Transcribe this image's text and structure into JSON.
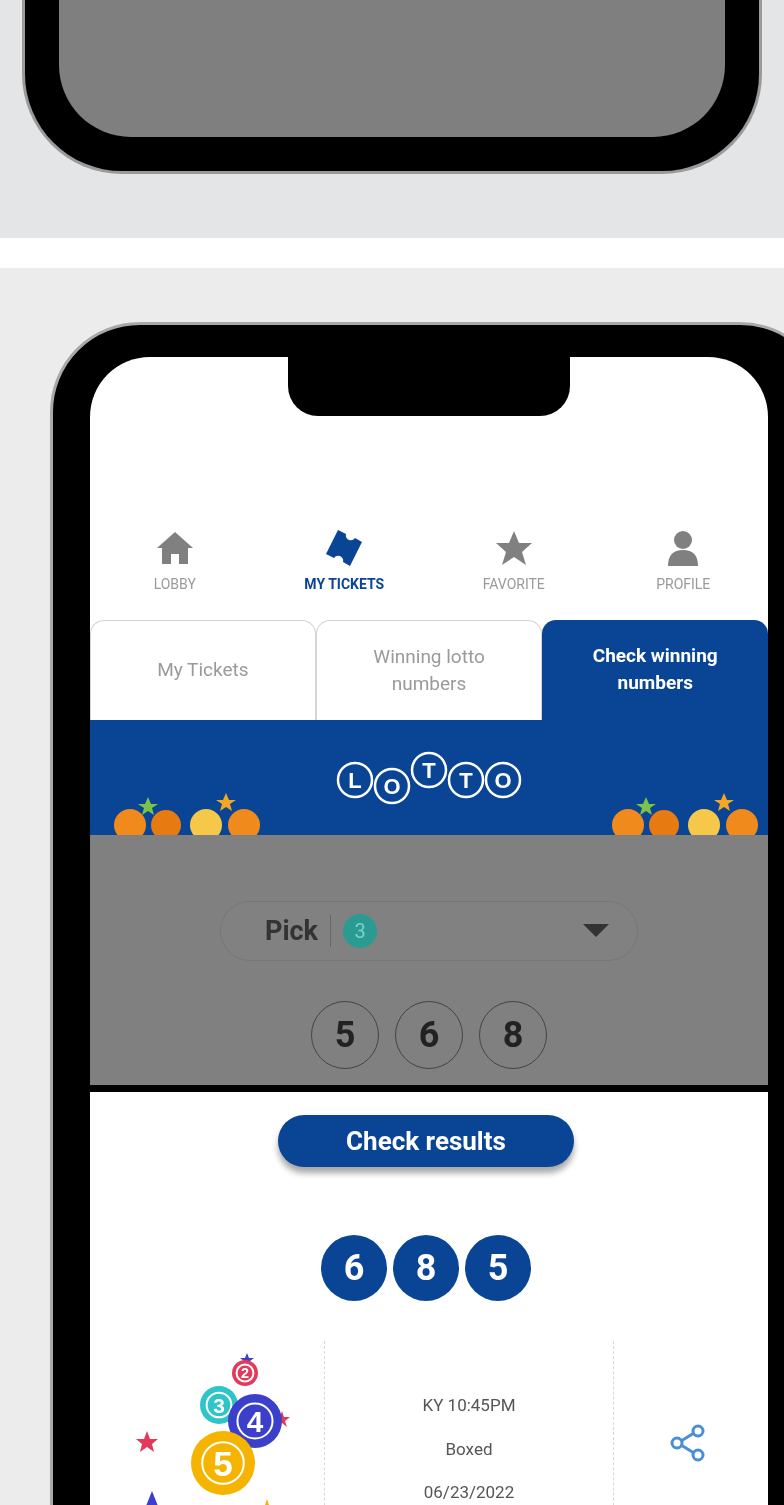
{
  "nav": [
    {
      "label": "LOBBY",
      "kind": "home",
      "selected": false
    },
    {
      "label": "MY TICKETS",
      "kind": "ticket",
      "selected": true
    },
    {
      "label": "FAVORITE",
      "kind": "star",
      "selected": false
    },
    {
      "label": "PROFILE",
      "kind": "person",
      "selected": false
    }
  ],
  "tabs": [
    {
      "label": "My Tickets",
      "selected": false
    },
    {
      "label": "Winning lotto numbers",
      "selected": false
    },
    {
      "label": "Check winning numbers",
      "selected": true
    }
  ],
  "logo": {
    "letters": [
      "L",
      "O",
      "T",
      "T",
      "O"
    ]
  },
  "pick": {
    "label": "Pick",
    "value": "3"
  },
  "entered_numbers": [
    "5",
    "6",
    "8"
  ],
  "check_button": "Check results",
  "winning_numbers": [
    "6",
    "8",
    "5"
  ],
  "result": {
    "illustration_balls": [
      "2",
      "3",
      "4",
      "5"
    ],
    "draw": "KY 10:45PM",
    "play_type": "Boxed",
    "date": "06/23/2022"
  }
}
